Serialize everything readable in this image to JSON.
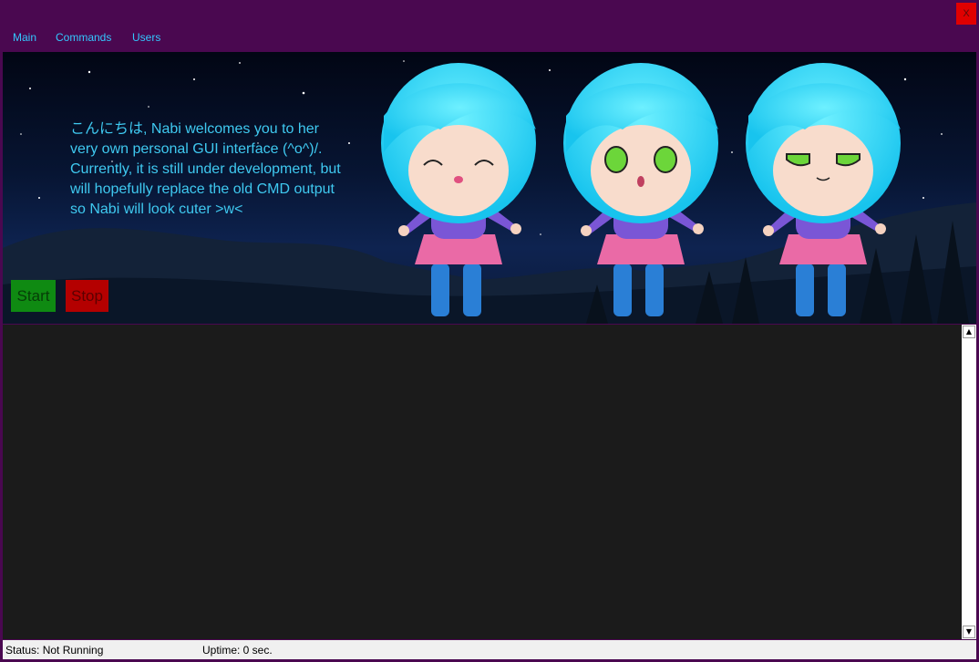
{
  "window": {
    "close_label": "X"
  },
  "menu": {
    "items": [
      "Main",
      "Commands",
      "Users"
    ]
  },
  "banner": {
    "welcome_text": "こんにちは, Nabi welcomes you to her very own personal GUI interface (^o^)/. Currently, it is still under development, but will hopefully replace the old CMD output so Nabi will look cuter >w<",
    "start_label": "Start",
    "stop_label": "Stop"
  },
  "scrollbar": {
    "up_icon": "▲",
    "down_icon": "▼"
  },
  "status": {
    "status_text": "Status: Not Running",
    "uptime_text": "Uptime: 0 sec."
  },
  "colors": {
    "window_frame": "#4a0850",
    "menu_text": "#33c8ff",
    "start_button": "#0f8a12",
    "stop_button": "#b40000",
    "console_bg": "#1b1b1b"
  }
}
